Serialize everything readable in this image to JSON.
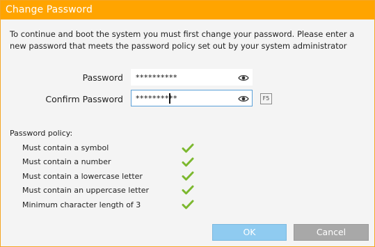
{
  "dialog": {
    "title": "Change Password",
    "intro": "To continue and boot the system you must first change your password. Please enter a new password that meets the password policy set out by your system administrator"
  },
  "form": {
    "password_label": "Password",
    "password_value": "**********",
    "confirm_label": "Confirm Password",
    "confirm_value": "**********",
    "fkey_label": "F5"
  },
  "policy": {
    "title": "Password policy:",
    "items": [
      {
        "label": "Must contain a symbol",
        "met": true
      },
      {
        "label": "Must contain a number",
        "met": true
      },
      {
        "label": "Must contain a lowercase letter",
        "met": true
      },
      {
        "label": "Must contain an uppercase letter",
        "met": true
      },
      {
        "label": "Minimum character length of 3",
        "met": true
      }
    ],
    "check_color": "#7cb82f"
  },
  "buttons": {
    "ok_label": "OK",
    "cancel_label": "Cancel"
  },
  "colors": {
    "title_bar": "#ffa400",
    "ok_button": "#8fcbf0",
    "cancel_button": "#a8a8a8",
    "focus_border": "#5aa0d8"
  }
}
